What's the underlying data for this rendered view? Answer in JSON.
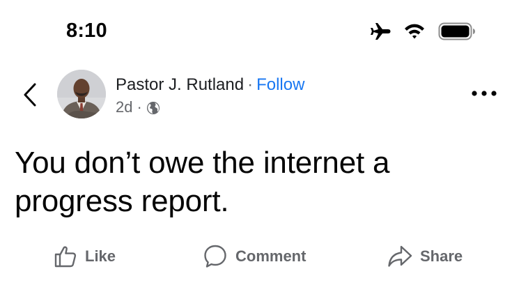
{
  "status_bar": {
    "time": "8:10",
    "icons": [
      "airplane-icon",
      "wifi-icon",
      "battery-icon"
    ]
  },
  "post": {
    "author": "Pastor J. Rutland",
    "separator": "·",
    "follow_label": "Follow",
    "timestamp": "2d",
    "meta_separator": "·",
    "audience_icon": "globe-icon",
    "text": "You don’t owe the internet a progress report."
  },
  "actions": {
    "like_label": "Like",
    "comment_label": "Comment",
    "share_label": "Share"
  },
  "colors": {
    "link_blue": "#1877f2",
    "secondary_text": "#65676b",
    "primary_text": "#050505"
  }
}
